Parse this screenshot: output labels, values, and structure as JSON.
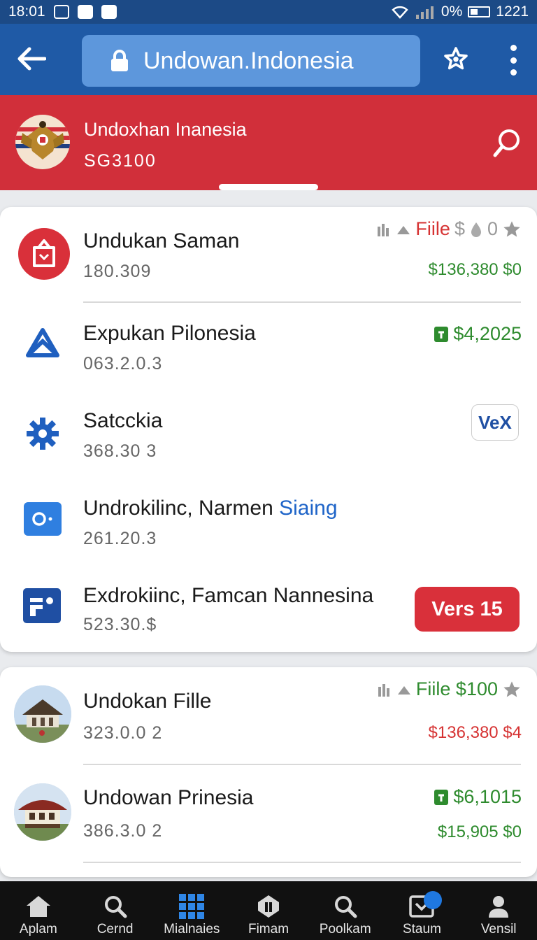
{
  "status_bar": {
    "time": "18:01",
    "battery_percent": "0%",
    "clock_right": "1221"
  },
  "browser": {
    "url": "Undowan.Indonesia"
  },
  "header": {
    "title": "Undoxhan Inanesia",
    "subtitle": "SG3100"
  },
  "list1": [
    {
      "title": "Undukan Saman",
      "subtitle": "180.309",
      "meta_label": "Fiile",
      "meta_mid": "$",
      "meta_count": "0",
      "amount": "$136,380 $0"
    },
    {
      "title": "Expukan Pilonesia",
      "subtitle": "063.2.0.3",
      "amount": "$4,2025"
    },
    {
      "title": "Satcckia",
      "subtitle": "368.30 3",
      "button": "VeX"
    },
    {
      "title": "Undrokilinc, Narmen",
      "title_highlight": "Siaing",
      "subtitle": "261.20.3"
    },
    {
      "title": "Exdrokiinc, Famcan Nannesina",
      "subtitle": "523.30.$",
      "button": "Vers 15"
    }
  ],
  "list2": [
    {
      "title": "Undokan Fille",
      "subtitle": "323.0.0 2",
      "meta_label": "Fiile $100",
      "amount": "$136,380 $4"
    },
    {
      "title": "Undowan Prinesia",
      "subtitle": "386.3.0 2",
      "amount_top": "$6,1015",
      "amount": "$15,905 $0"
    }
  ],
  "bottom_nav": [
    {
      "label": "Aplam",
      "icon": "home-icon"
    },
    {
      "label": "Cernd",
      "icon": "search-icon"
    },
    {
      "label": "Mialnaies",
      "icon": "grid-icon"
    },
    {
      "label": "Fimam",
      "icon": "shield-icon"
    },
    {
      "label": "Poolkam",
      "icon": "search-icon"
    },
    {
      "label": "Staum",
      "icon": "inbox-icon"
    },
    {
      "label": "Vensil",
      "icon": "user-icon"
    }
  ],
  "colors": {
    "browser_bar": "#1f5aa6",
    "header_red": "#d12f3a",
    "accent_green": "#2e8b2e",
    "accent_red": "#d63333",
    "accent_blue": "#1e64c8"
  }
}
